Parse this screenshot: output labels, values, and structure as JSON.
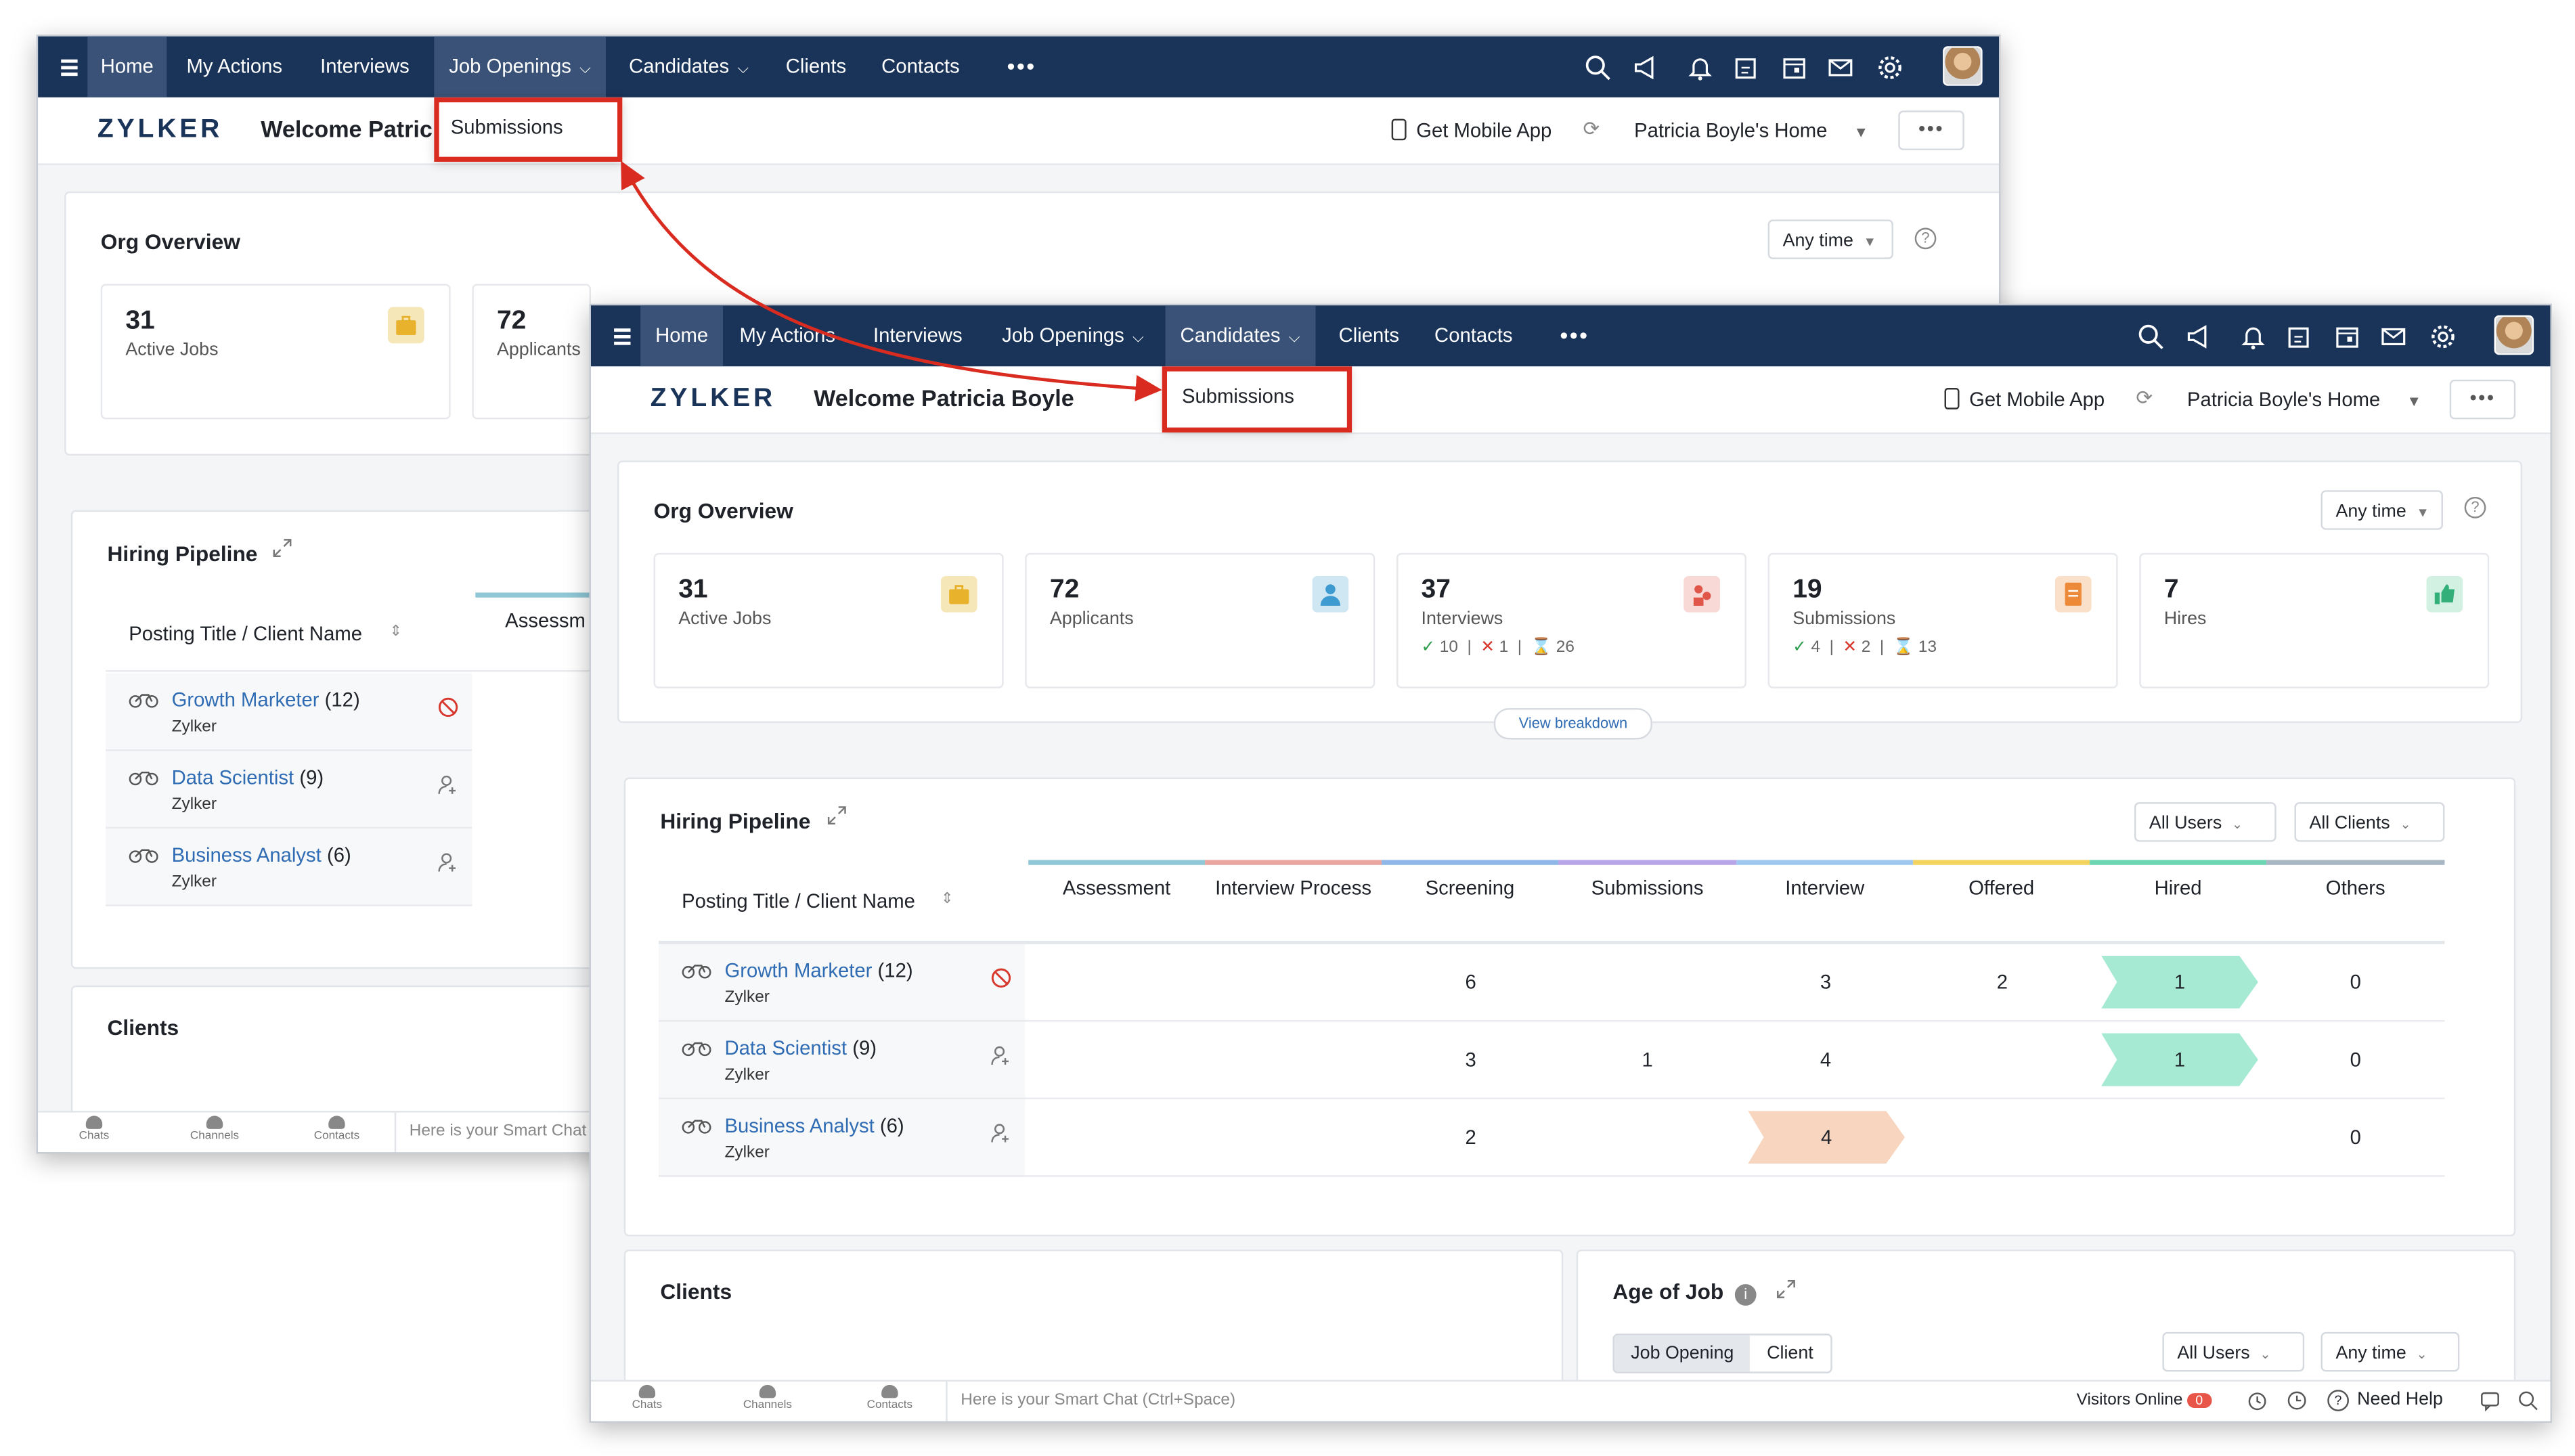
{
  "nav": {
    "items": [
      "Home",
      "My Actions",
      "Interviews",
      "Job Openings",
      "Candidates",
      "Clients",
      "Contacts"
    ],
    "more": "•••"
  },
  "header": {
    "logo": "ZYLKER",
    "welcome_a": "Welcome Patric",
    "welcome_b": "Welcome Patricia Boyle",
    "mobile_app": "Get Mobile App",
    "home_selector": "Patricia Boyle's Home",
    "more": "•••"
  },
  "dropdown": {
    "item": "Submissions"
  },
  "org_overview": {
    "title": "Org Overview",
    "time_filter": "Any time",
    "stats": [
      {
        "num": "31",
        "label": "Active Jobs"
      },
      {
        "num": "72",
        "label": "Applicants"
      },
      {
        "num": "37",
        "label": "Interviews",
        "ok": "10",
        "no": "1",
        "pending": "26"
      },
      {
        "num": "19",
        "label": "Submissions",
        "ok": "4",
        "no": "2",
        "pending": "13"
      },
      {
        "num": "7",
        "label": "Hires"
      }
    ],
    "view_breakdown": "View breakdown"
  },
  "pipeline": {
    "title": "Hiring Pipeline",
    "filters": {
      "users": "All Users",
      "clients": "All Clients"
    },
    "col_title": "Posting Title / Client Name",
    "columns": [
      "Assessment",
      "Interview Process",
      "Screening",
      "Submissions",
      "Interview",
      "Offered",
      "Hired",
      "Others"
    ],
    "partial_column": "Assessm",
    "rows": [
      {
        "title": "Growth Marketer",
        "count": "(12)",
        "client": "Zylker",
        "screening": "6",
        "submissions": "",
        "interview": "3",
        "offered": "2",
        "hired": "1",
        "others": "0"
      },
      {
        "title": "Data Scientist",
        "count": "(9)",
        "client": "Zylker",
        "screening": "3",
        "submissions": "1",
        "interview": "4",
        "offered": "",
        "hired": "1",
        "others": "0"
      },
      {
        "title": "Business Analyst",
        "count": "(6)",
        "client": "Zylker",
        "screening": "2",
        "submissions": "",
        "interview": "4",
        "offered": "",
        "hired": "",
        "others": "0"
      }
    ],
    "colors": {
      "assessment": "#e58f84",
      "interview_process": "#e9a6a0",
      "screening": "#8fb7e8",
      "submissions": "#b8a6e8",
      "interview": "#9fc8f0",
      "offered": "#f3d35d",
      "hired": "#6cd6b3",
      "others": "#a9b6c4"
    }
  },
  "clients": {
    "title": "Clients"
  },
  "age_of_job": {
    "title": "Age of Job",
    "seg": [
      "Job Opening",
      "Client"
    ],
    "users": "All Users",
    "time": "Any time"
  },
  "bottombar": {
    "chats": "Chats",
    "channels": "Channels",
    "contacts": "Contacts",
    "smart_chat_a": "Here is your Smart Chat",
    "smart_chat_b": "Here is your Smart Chat (Ctrl+Space)",
    "visitors": "Visitors Online",
    "visitors_count": "0",
    "need_help": "Need Help"
  }
}
